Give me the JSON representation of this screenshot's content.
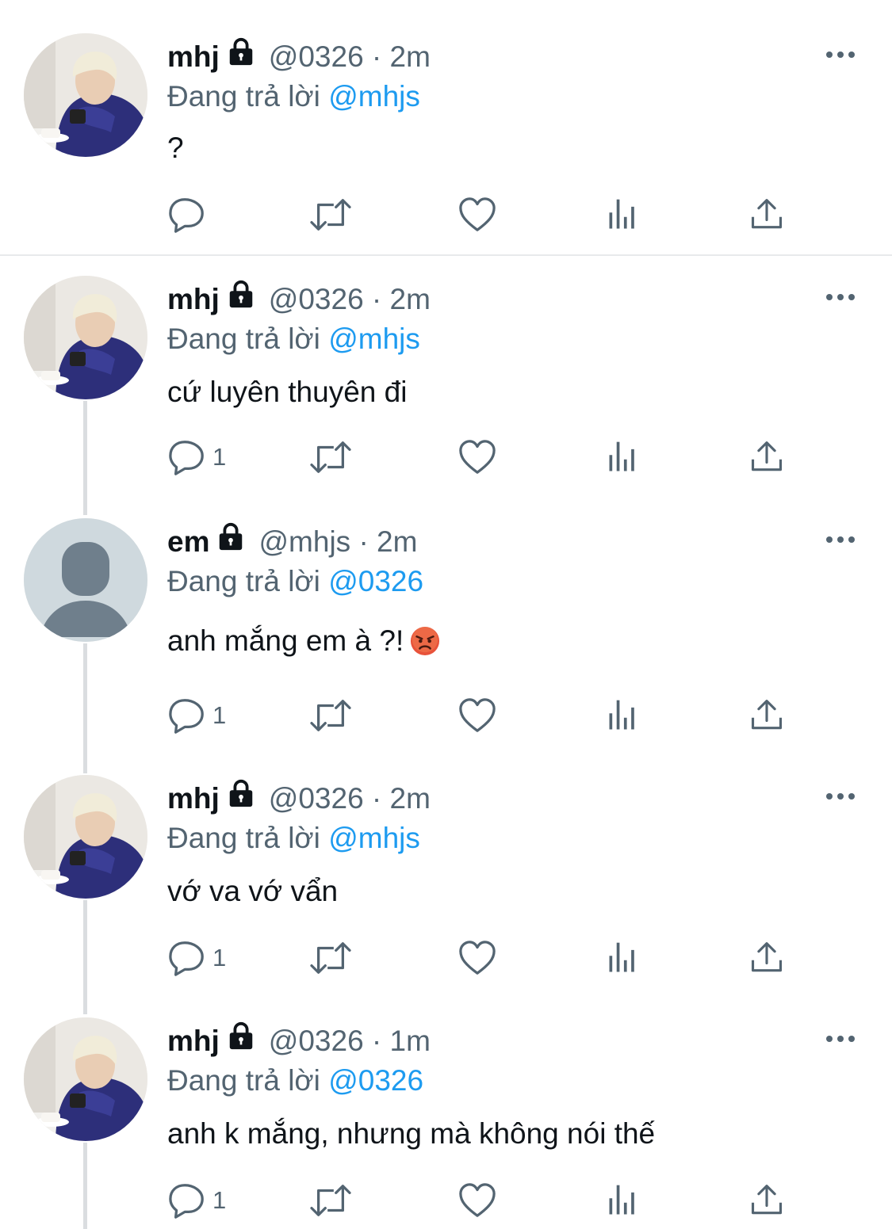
{
  "tweets": [
    {
      "name": "mhj",
      "handle_time": "@0326 · 2m",
      "replying_prefix": "Đang trả lời",
      "replying_mention": "@mhjs",
      "text": "?",
      "reply_count": "",
      "avatar": "photo-avatar"
    },
    {
      "name": "mhj",
      "handle_time": "@0326 · 2m",
      "replying_prefix": "Đang trả lời",
      "replying_mention": "@mhjs",
      "text": "cứ luyên thuyên đi",
      "reply_count": "1",
      "avatar": "photo-avatar"
    },
    {
      "name": "em",
      "handle_time": "@mhjs · 2m",
      "replying_prefix": "Đang trả lời",
      "replying_mention": "@0326",
      "text": "anh mắng em à ?!",
      "emoji": "angry-face-emoji",
      "reply_count": "1",
      "avatar": "default-avatar"
    },
    {
      "name": "mhj",
      "handle_time": "@0326 · 2m",
      "replying_prefix": "Đang trả lời",
      "replying_mention": "@mhjs",
      "text": "vớ va vớ vẩn",
      "reply_count": "1",
      "avatar": "photo-avatar"
    },
    {
      "name": "mhj",
      "handle_time": "@0326 · 1m",
      "replying_prefix": "Đang trả lời",
      "replying_mention": "@0326",
      "text": "anh k mắng, nhưng mà không nói thế",
      "reply_count": "1",
      "avatar": "photo-avatar"
    }
  ],
  "colors": {
    "mention": "#1d9bf0",
    "secondary_text": "#536471",
    "primary_text": "#0f1419",
    "thread_line": "#dadde0"
  },
  "icons": [
    "reply-icon",
    "retweet-icon",
    "like-icon",
    "views-icon",
    "share-icon",
    "lock-icon",
    "more-icon"
  ]
}
